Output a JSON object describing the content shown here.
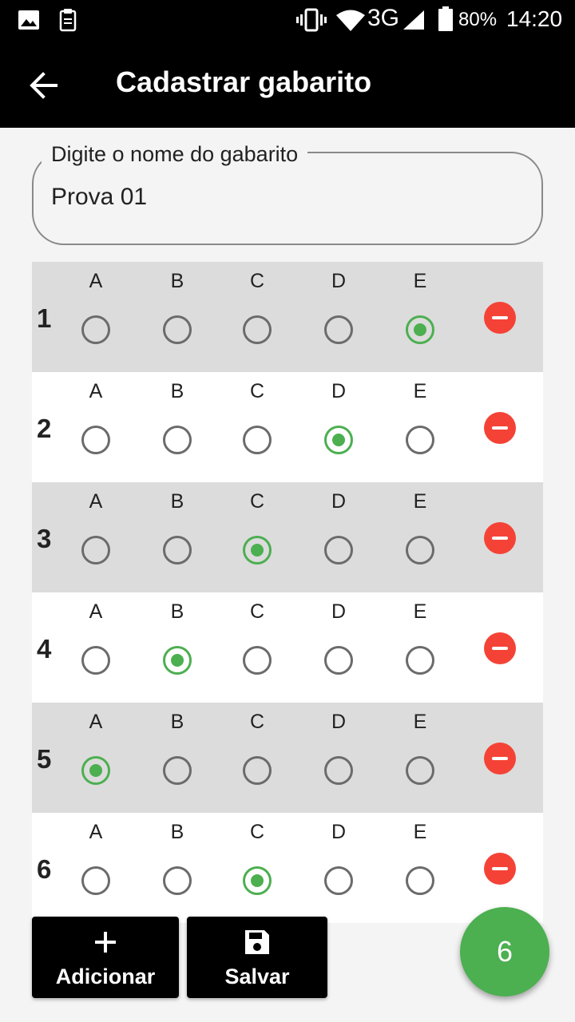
{
  "status_bar": {
    "battery": "80%",
    "time": "14:20",
    "network": "3G",
    "icons": [
      "image-icon",
      "clipboard-icon",
      "vibrate-icon",
      "wifi-icon",
      "signal-icon",
      "battery-icon"
    ]
  },
  "app_bar": {
    "title": "Cadastrar gabarito",
    "back_icon": "arrow-back-icon"
  },
  "name_field": {
    "label": "Digite o nome do gabarito",
    "value": "Prova 01"
  },
  "questions": [
    {
      "number": "1",
      "options": [
        "A",
        "B",
        "C",
        "D",
        "E"
      ],
      "selected": "E"
    },
    {
      "number": "2",
      "options": [
        "A",
        "B",
        "C",
        "D",
        "E"
      ],
      "selected": "D"
    },
    {
      "number": "3",
      "options": [
        "A",
        "B",
        "C",
        "D",
        "E"
      ],
      "selected": "C"
    },
    {
      "number": "4",
      "options": [
        "A",
        "B",
        "C",
        "D",
        "E"
      ],
      "selected": "B"
    },
    {
      "number": "5",
      "options": [
        "A",
        "B",
        "C",
        "D",
        "E"
      ],
      "selected": "A"
    },
    {
      "number": "6",
      "options": [
        "A",
        "B",
        "C",
        "D",
        "E"
      ],
      "selected": "C"
    }
  ],
  "buttons": {
    "add_label": "Adicionar",
    "add_icon": "plus-icon",
    "save_label": "Salvar",
    "save_icon": "save-icon"
  },
  "fab": {
    "count": "6"
  },
  "colors": {
    "selected": "#4caf50",
    "remove": "#f44336",
    "row_alt": "#dcdcdc",
    "bar": "#000000"
  }
}
